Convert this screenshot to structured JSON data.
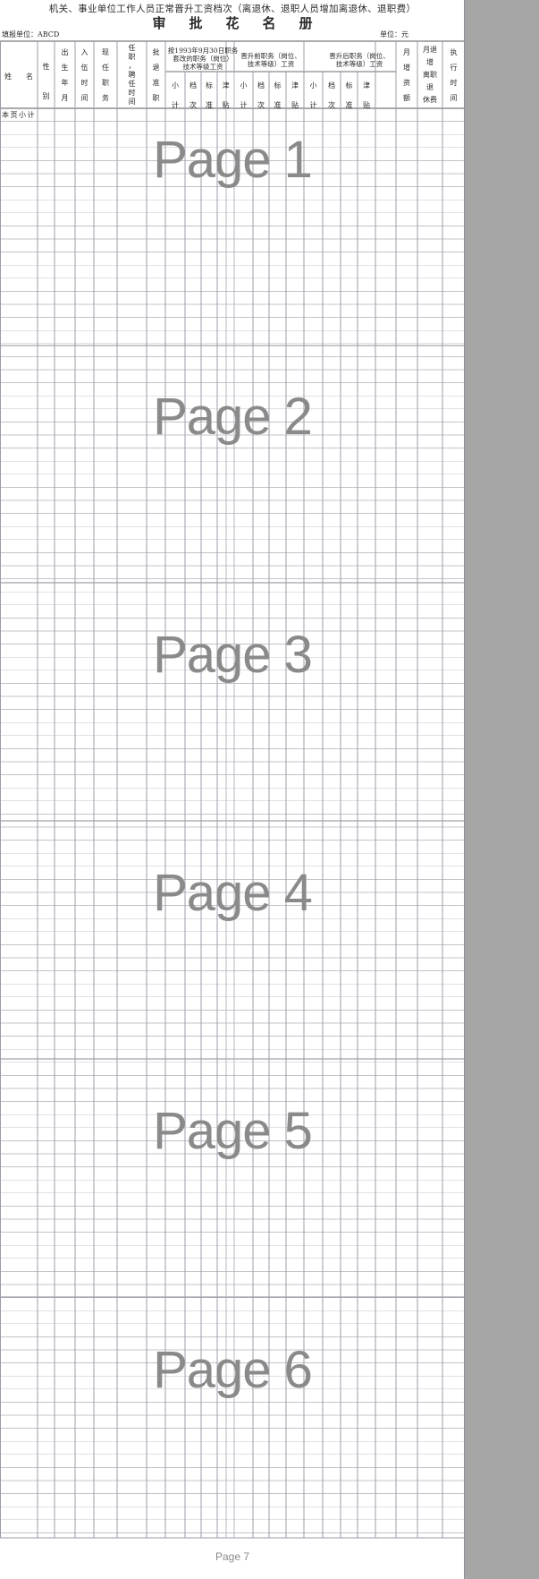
{
  "document": {
    "title_line1": "机关、事业单位工作人员正常晋升工资档次（离退休、退职人员增加离退休、退职费）",
    "title_line2": "审批花名册",
    "fill_unit": "填报单位：ABCD",
    "unit": "单位：元",
    "subtotal_label": "本页小计"
  },
  "columns": {
    "name": [
      "姓",
      "名"
    ],
    "gender": [
      "性",
      "别"
    ],
    "birth": [
      "出",
      "生",
      "年",
      "月"
    ],
    "join": [
      "入",
      "伍",
      "时",
      "间"
    ],
    "current_post": [
      "现",
      "任",
      "职",
      "务"
    ],
    "appoint_time": [
      "任",
      "职",
      "，",
      "聘",
      "任",
      "时",
      "间"
    ],
    "approve_retire": [
      "批",
      "退",
      "准",
      "职"
    ],
    "group1": [
      "按1993年9月30日职务",
      "套改的职务（岗位）",
      "技术等级工资"
    ],
    "group2": [
      "晋升前职务（岗位、",
      "技术等级）工资"
    ],
    "group3": [
      "晋升后职务（岗位、",
      "技术等级）工资"
    ],
    "sub_headers": [
      [
        "小",
        "计"
      ],
      [
        "档",
        "次"
      ],
      [
        "标",
        "准"
      ],
      [
        "津",
        "贴"
      ]
    ],
    "monthly_increase": [
      "月",
      "增",
      "资",
      "额"
    ],
    "monthly_retire_increase": [
      "月退",
      "增",
      "离职",
      "退",
      "休费"
    ],
    "effective_time": [
      "执",
      "行",
      "时",
      "间"
    ]
  },
  "watermarks": [
    "Page 1",
    "Page 2",
    "Page 3",
    "Page 4",
    "Page 5",
    "Page 6"
  ],
  "footer_page": "Page 7"
}
